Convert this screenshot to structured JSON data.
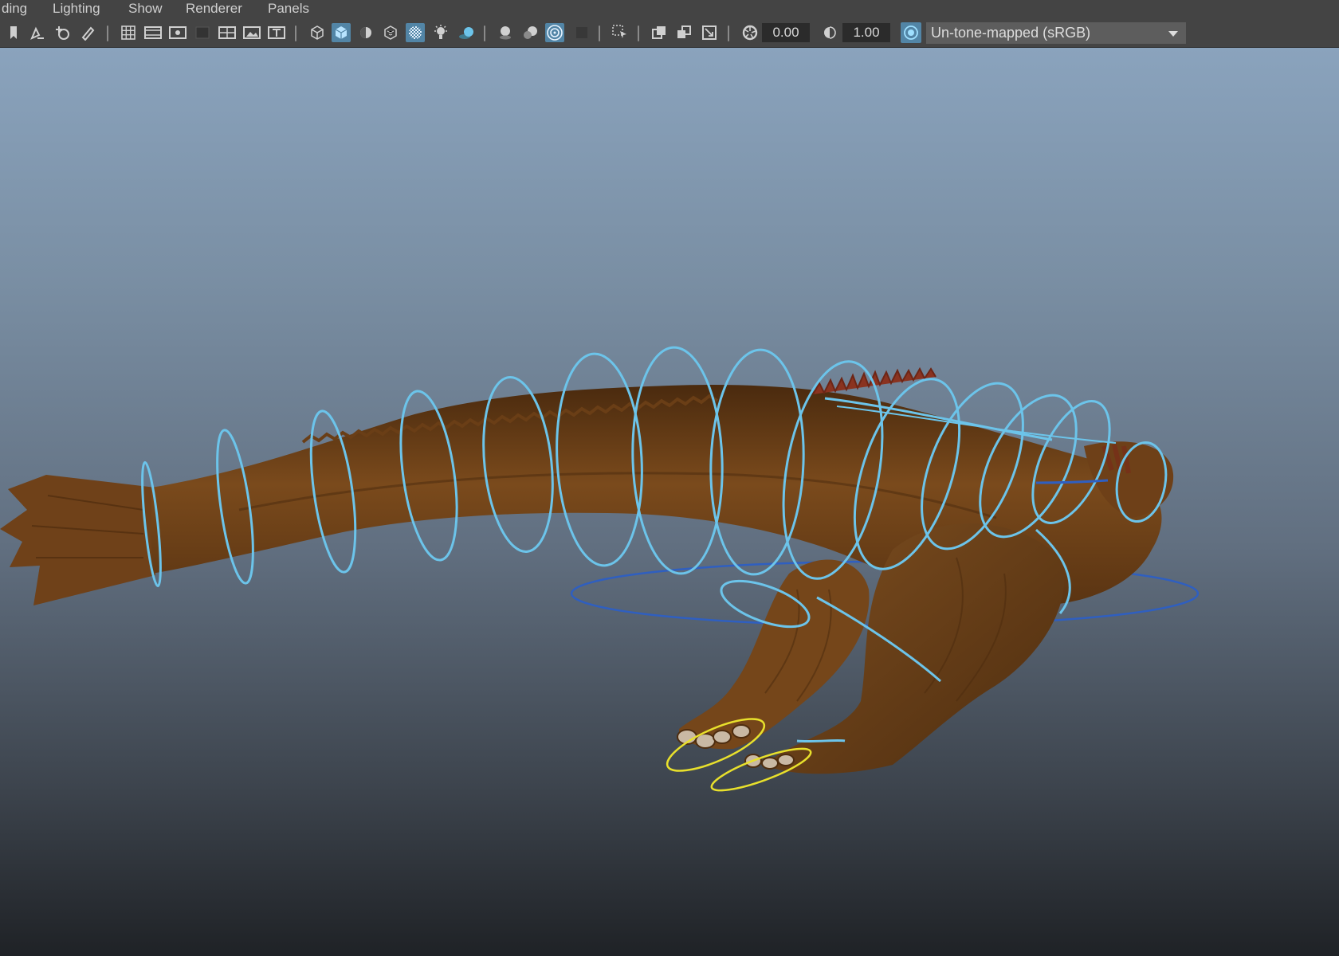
{
  "menu": [
    "ding",
    "Lighting",
    "Show",
    "Renderer",
    "Panels"
  ],
  "toolbar": {
    "exposure_value": "0.00",
    "gamma_value": "1.00",
    "color_space": "Un-tone-mapped (sRGB)",
    "icons": [
      "bookmark-icon",
      "select-camera-icon",
      "camera-tumble-icon",
      "grease-pencil-icon",
      "grid-icon",
      "film-gate-icon",
      "resolution-gate-icon",
      "gate-mask-icon",
      "field-chart-icon",
      "safe-action-icon",
      "safe-title-icon",
      "wireframe-icon",
      "smooth-shade-icon",
      "wireframe-on-shaded-icon",
      "textured-icon",
      "xray-icon",
      "use-all-lights-icon",
      "shadows-icon",
      "screen-space-ao-icon",
      "motion-blur-icon",
      "anti-aliasing-icon",
      "depth-of-field-icon",
      "isolate-select-icon",
      "xray-joints-icon",
      "xray-active-icon",
      "backface-culling-icon",
      "exposure-icon",
      "gamma-icon",
      "color-management-icon"
    ],
    "accent": "#5285a6"
  },
  "viewport": {
    "sky_top": "#8aa3bd",
    "floor_bottom": "#1f2226",
    "creature_color": "#6e4018",
    "control_color": "#6cc4ea",
    "selected_control_color": "#e8e02c",
    "root_control_color": "#2f5fc0"
  }
}
